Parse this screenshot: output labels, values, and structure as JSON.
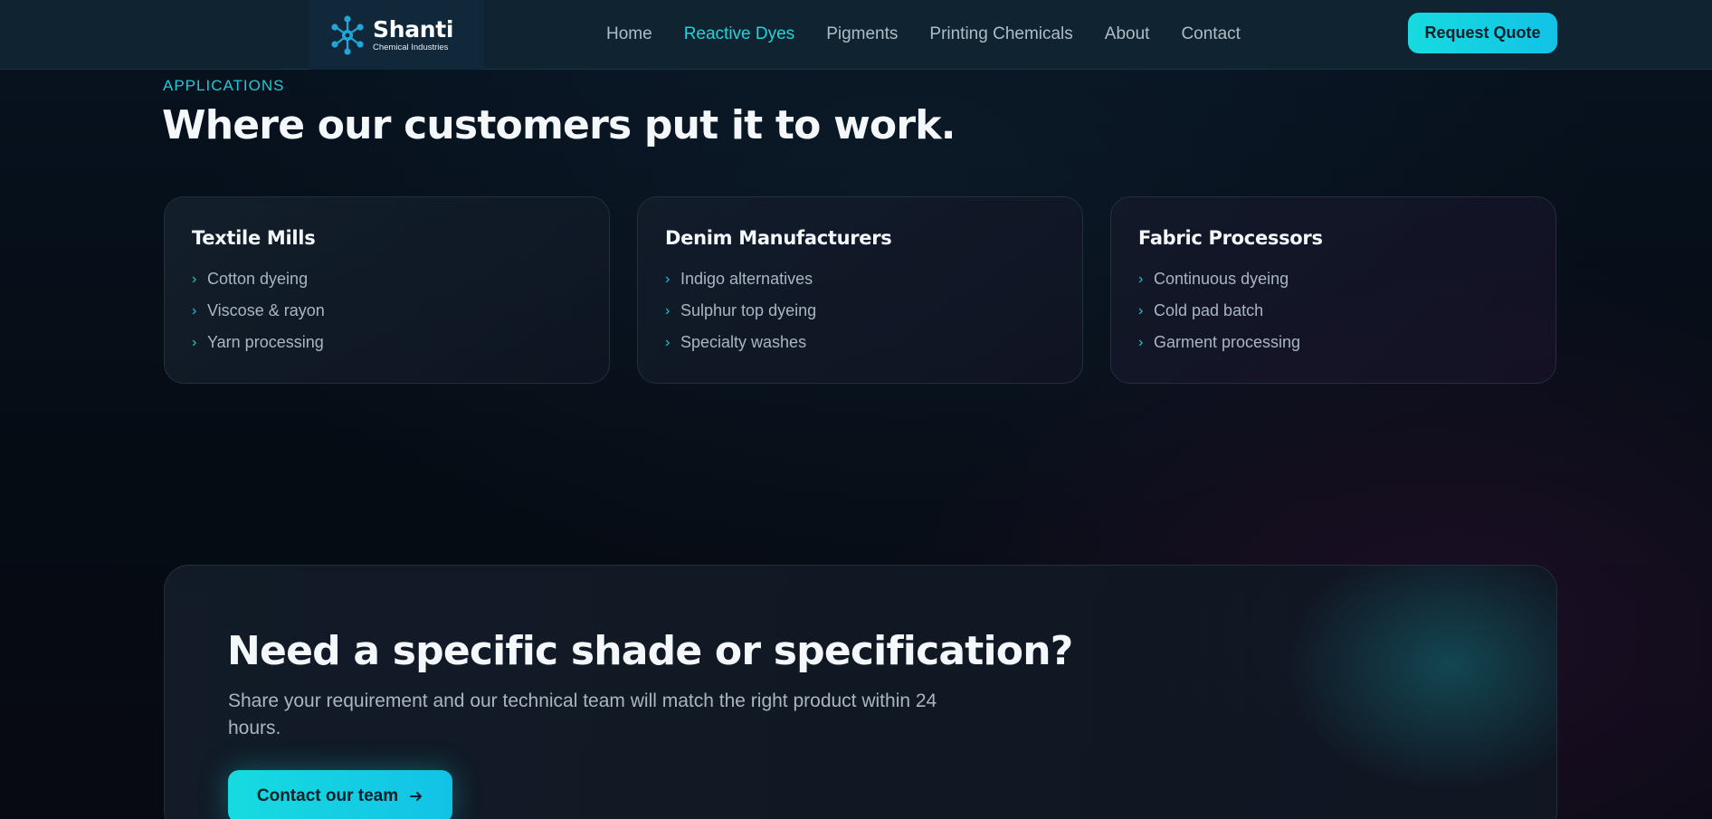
{
  "brand": {
    "name": "Shanti",
    "tagline": "Chemical Industries",
    "accent": "#22d3d8"
  },
  "nav": {
    "items": [
      {
        "label": "Home",
        "active": false
      },
      {
        "label": "Reactive Dyes",
        "active": true
      },
      {
        "label": "Pigments",
        "active": false
      },
      {
        "label": "Printing Chemicals",
        "active": false
      },
      {
        "label": "About",
        "active": false
      },
      {
        "label": "Contact",
        "active": false
      }
    ],
    "cta_label": "Request Quote"
  },
  "applications": {
    "eyebrow": "APPLICATIONS",
    "title": "Where our customers put it to work.",
    "cards": [
      {
        "title": "Textile Mills",
        "items": [
          "Cotton dyeing",
          "Viscose & rayon",
          "Yarn processing"
        ]
      },
      {
        "title": "Denim Manufacturers",
        "items": [
          "Indigo alternatives",
          "Sulphur top dyeing",
          "Specialty washes"
        ]
      },
      {
        "title": "Fabric Processors",
        "items": [
          "Continuous dyeing",
          "Cold pad batch",
          "Garment processing"
        ]
      }
    ]
  },
  "cta": {
    "title": "Need a specific shade or specification?",
    "text": "Share your requirement and our technical team will match the right product within 24 hours.",
    "button_label": "Contact our team",
    "button_icon": "arrow-right-icon"
  }
}
